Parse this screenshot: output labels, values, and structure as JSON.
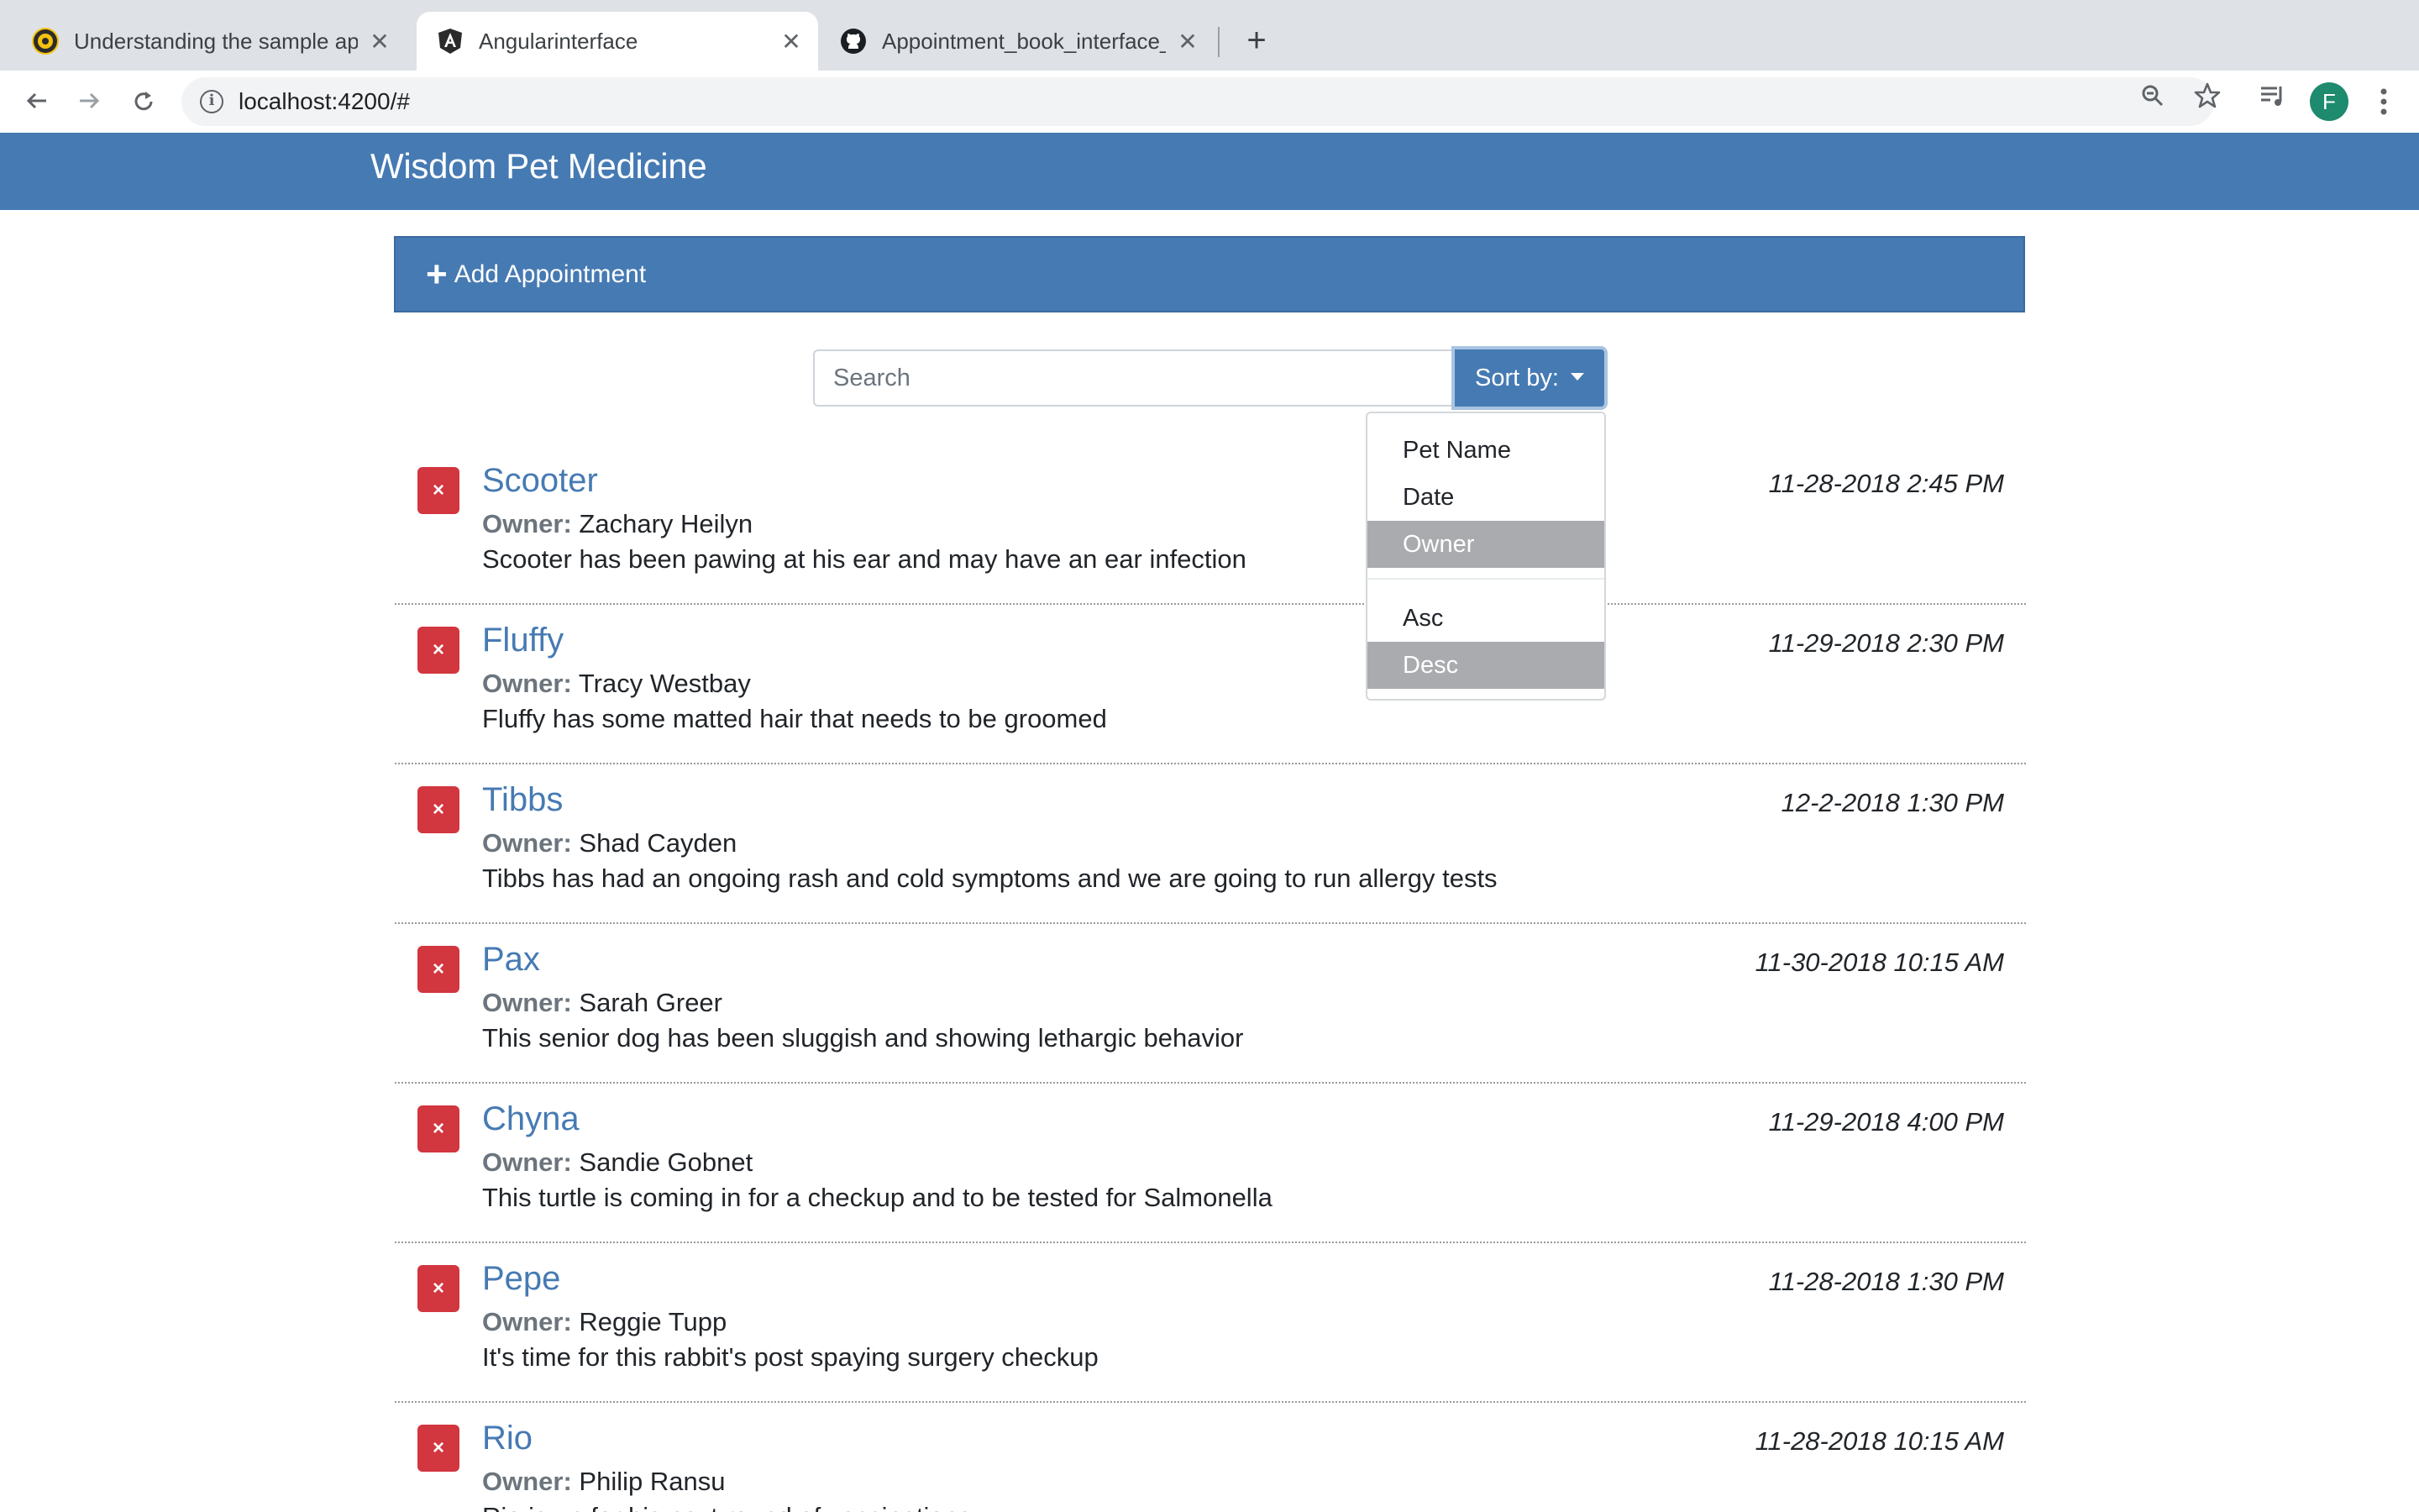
{
  "browser": {
    "tabs": [
      {
        "title": "Understanding the sample app",
        "active": false
      },
      {
        "title": "Angularinterface",
        "active": true
      },
      {
        "title": "Appointment_book_interface_w",
        "active": false
      }
    ],
    "url": "localhost:4200/#",
    "profile_initial": "F"
  },
  "app": {
    "brand": "Wisdom Pet Medicine",
    "add_label": "Add Appointment",
    "search_placeholder": "Search",
    "sort_label": "Sort by:",
    "sort_menu": {
      "fields": [
        "Pet Name",
        "Date",
        "Owner"
      ],
      "active_field": "Owner",
      "orders": [
        "Asc",
        "Desc"
      ],
      "active_order": "Desc"
    },
    "owner_label": "Owner:",
    "delete_glyph": "×",
    "appointments": [
      {
        "pet": "Scooter",
        "owner": "Zachary Heilyn",
        "notes": "Scooter has been pawing at his ear and may have an ear infection",
        "date": "11-28-2018 2:45 PM"
      },
      {
        "pet": "Fluffy",
        "owner": "Tracy Westbay",
        "notes": "Fluffy has some matted hair that needs to be groomed",
        "date": "11-29-2018 2:30 PM"
      },
      {
        "pet": "Tibbs",
        "owner": "Shad Cayden",
        "notes": "Tibbs has had an ongoing rash and cold symptoms and we are going to run allergy tests",
        "date": "12-2-2018 1:30 PM"
      },
      {
        "pet": "Pax",
        "owner": "Sarah Greer",
        "notes": "This senior dog has been sluggish and showing lethargic behavior",
        "date": "11-30-2018 10:15 AM"
      },
      {
        "pet": "Chyna",
        "owner": "Sandie Gobnet",
        "notes": "This turtle is coming in for a checkup and to be tested for Salmonella",
        "date": "11-29-2018 4:00 PM"
      },
      {
        "pet": "Pepe",
        "owner": "Reggie Tupp",
        "notes": "It's time for this rabbit's post spaying surgery checkup",
        "date": "11-28-2018 1:30 PM"
      },
      {
        "pet": "Rio",
        "owner": "Philip Ransu",
        "notes": "Rio is up for his next round of vaccinations",
        "date": "11-28-2018 10:15 AM"
      }
    ]
  },
  "colors": {
    "primary": "#467ab3",
    "danger": "#d2363f",
    "menu_active": "#a9abae",
    "chrome_bg": "#dee1e6"
  }
}
